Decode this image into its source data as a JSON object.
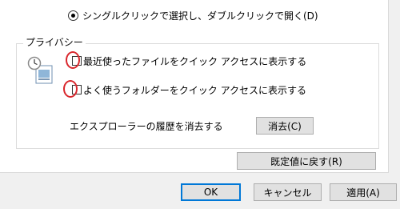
{
  "view": {
    "click_mode_label": "シングルクリックで選択し、ダブルクリックで開く(D)",
    "click_mode_selected": true
  },
  "privacy": {
    "group_title": "プライバシー",
    "show_recent_files_label": "最近使ったファイルをクイック アクセスに表示する",
    "show_recent_files_checked": false,
    "show_frequent_folders_label": "よく使うフォルダーをクイック アクセスに表示する",
    "show_frequent_folders_checked": false,
    "clear_history_label": "エクスプローラーの履歴を消去する",
    "clear_button": "消去(C)"
  },
  "restore_defaults_button": "既定値に戻す(R)",
  "dialog_buttons": {
    "ok": "OK",
    "cancel": "キャンセル",
    "apply": "適用(A)"
  },
  "annotation_color": "#d9262c"
}
